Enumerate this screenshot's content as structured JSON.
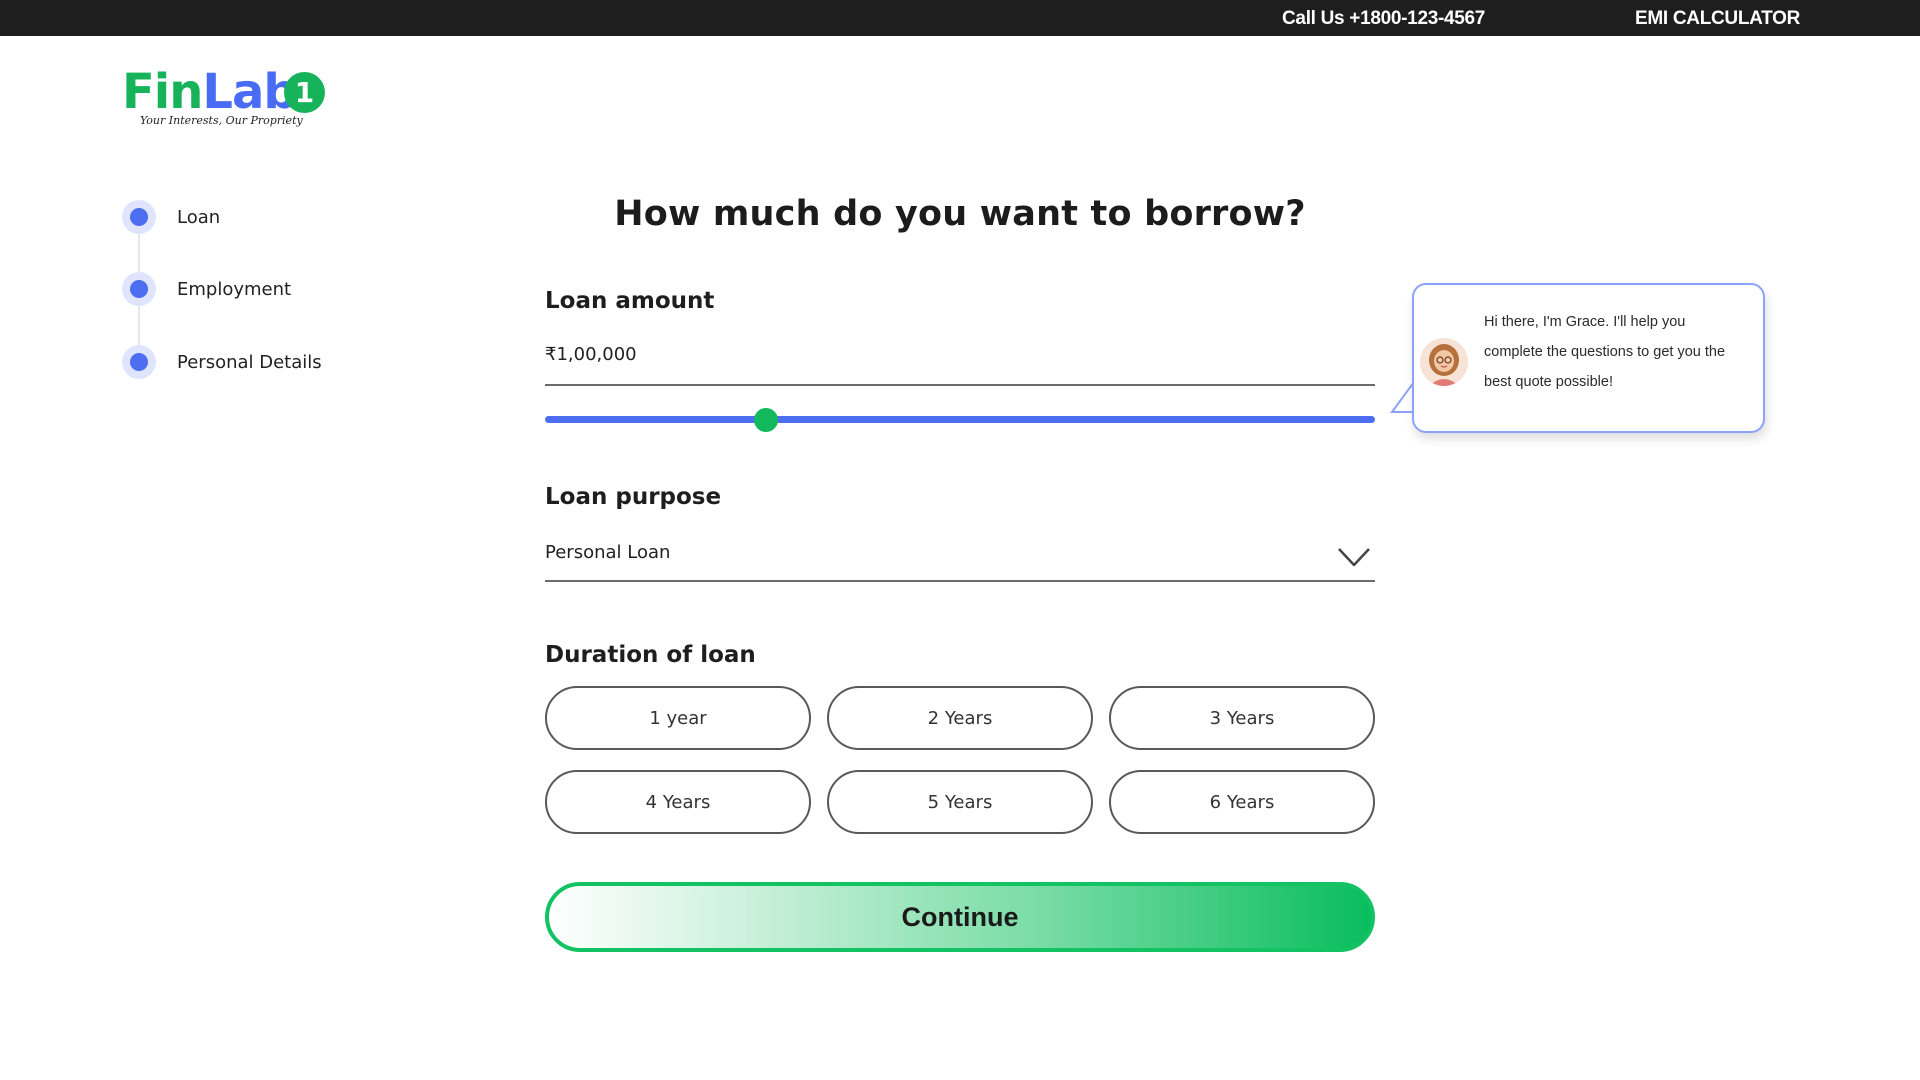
{
  "topbar": {
    "call_text": "Call Us +1800-123-4567",
    "emi_link": "EMI CALCULATOR"
  },
  "logo": {
    "part1": "Fin",
    "part2": "Lab",
    "badge": "1",
    "tagline": "Your Interests, Our Propriety"
  },
  "steps": [
    {
      "label": "Loan"
    },
    {
      "label": "Employment"
    },
    {
      "label": "Personal Details"
    }
  ],
  "form": {
    "title": "How much do you want to borrow?",
    "amount_label": "Loan amount",
    "amount_value": "₹1,00,000",
    "slider_fraction": 0.266,
    "purpose_label": "Loan purpose",
    "purpose_value": "Personal Loan",
    "duration_label": "Duration of loan",
    "durations": [
      "1 year",
      "2 Years",
      "3 Years",
      "4 Years",
      "5 Years",
      "6 Years"
    ],
    "continue_label": "Continue"
  },
  "chat": {
    "message": "Hi there, I'm Grace. I'll help you complete the questions to get you the best quote possible!"
  },
  "colors": {
    "brand_green": "#17b35a",
    "brand_blue": "#4a6cf5",
    "topbar_bg": "#1e1e1e",
    "step_dot": "#4e6ef2",
    "bubble_border": "#8ca2f8"
  },
  "icons": {
    "dropdown": "chevron-down-icon",
    "avatar": "agent-avatar"
  }
}
